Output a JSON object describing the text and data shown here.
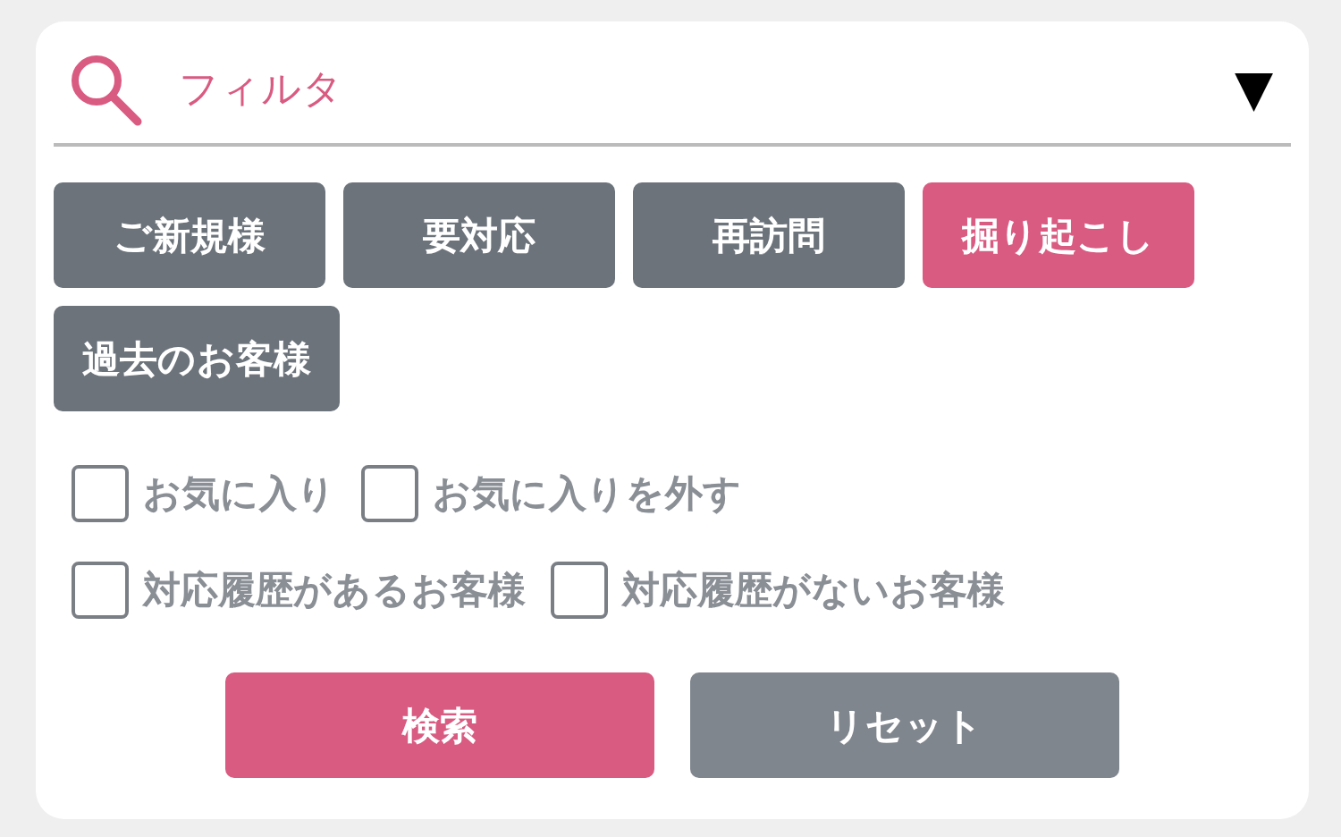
{
  "filter": {
    "placeholder": "フィルタ",
    "dropdown": "▼"
  },
  "tags": [
    {
      "label": "ご新規様",
      "selected": false
    },
    {
      "label": "要対応",
      "selected": false
    },
    {
      "label": "再訪問",
      "selected": false
    },
    {
      "label": "掘り起こし",
      "selected": true
    },
    {
      "label": "過去のお客様",
      "selected": false
    }
  ],
  "checkboxes": [
    [
      {
        "label": "お気に入り",
        "checked": false
      },
      {
        "label": "お気に入りを外す",
        "checked": false
      }
    ],
    [
      {
        "label": "対応履歴があるお客様",
        "checked": false
      },
      {
        "label": "対応履歴がないお客様",
        "checked": false
      }
    ]
  ],
  "buttons": [
    {
      "label": "検索",
      "kind": "primary"
    },
    {
      "label": "リセット",
      "kind": "secondary"
    }
  ]
}
